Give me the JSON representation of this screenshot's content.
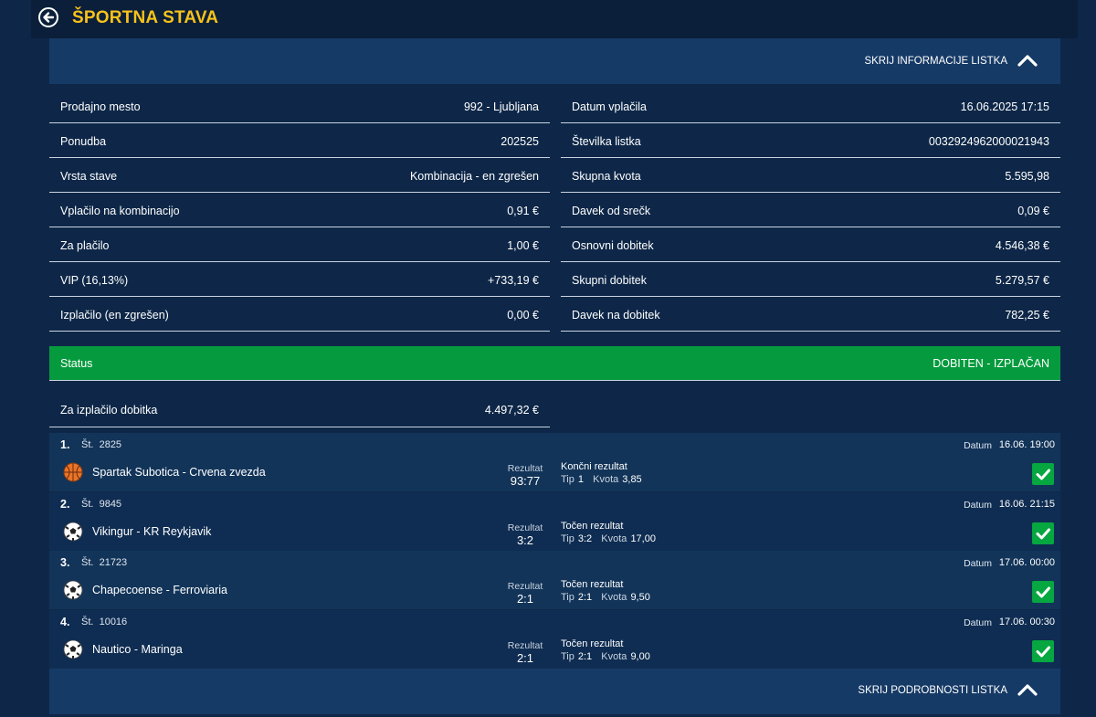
{
  "header": {
    "title": "ŠPORTNA STAVA"
  },
  "info_toggle": {
    "label": "SKRIJ INFORMACIJE LISTKA"
  },
  "info_left": [
    {
      "label": "Prodajno mesto",
      "value": "992 - Ljubljana"
    },
    {
      "label": "Ponudba",
      "value": "202525"
    },
    {
      "label": "Vrsta stave",
      "value": "Kombinacija - en zgrešen"
    },
    {
      "label": "Vplačilo na kombinacijo",
      "value": "0,91 €"
    },
    {
      "label": "Za plačilo",
      "value": "1,00 €"
    },
    {
      "label": "VIP (16,13%)",
      "value": "+733,19 €"
    },
    {
      "label": "Izplačilo (en zgrešen)",
      "value": "0,00 €"
    }
  ],
  "info_right": [
    {
      "label": "Datum vplačila",
      "value": "16.06.2025 17:15"
    },
    {
      "label": "Številka listka",
      "value": "0032924962000021943"
    },
    {
      "label": "Skupna kvota",
      "value": "5.595,98"
    },
    {
      "label": "Davek od srečk",
      "value": "0,09 €"
    },
    {
      "label": "Osnovni dobitek",
      "value": "4.546,38 €"
    },
    {
      "label": "Skupni dobitek",
      "value": "5.279,57 €"
    },
    {
      "label": "Davek na dobitek",
      "value": "782,25 €"
    }
  ],
  "status": {
    "label": "Status",
    "value": "DOBITEN - IZPLAČAN",
    "color": "#069a3e"
  },
  "payout": {
    "label": "Za izplačilo dobitka",
    "value": "4.497,32 €"
  },
  "matches": [
    {
      "num": "1.",
      "st_label": "Št.",
      "st": "2825",
      "date_label": "Datum",
      "date": "16.06. 19:00",
      "sport_icon": "basketball-icon",
      "name": "Spartak Subotica - Crvena zvezda",
      "result_label": "Rezultat",
      "result": "93:77",
      "market": "Končni rezultat",
      "tip_label": "Tip",
      "tip": "1",
      "odds_label": "Kvota",
      "odds": "3,85"
    },
    {
      "num": "2.",
      "st_label": "Št.",
      "st": "9845",
      "date_label": "Datum",
      "date": "16.06. 21:15",
      "sport_icon": "soccer-ball-icon",
      "name": "Vikingur - KR Reykjavik",
      "result_label": "Rezultat",
      "result": "3:2",
      "market": "Točen rezultat",
      "tip_label": "Tip",
      "tip": "3:2",
      "odds_label": "Kvota",
      "odds": "17,00"
    },
    {
      "num": "3.",
      "st_label": "Št.",
      "st": "21723",
      "date_label": "Datum",
      "date": "17.06. 00:00",
      "sport_icon": "soccer-ball-icon",
      "name": "Chapecoense - Ferroviaria",
      "result_label": "Rezultat",
      "result": "2:1",
      "market": "Točen rezultat",
      "tip_label": "Tip",
      "tip": "2:1",
      "odds_label": "Kvota",
      "odds": "9,50"
    },
    {
      "num": "4.",
      "st_label": "Št.",
      "st": "10016",
      "date_label": "Datum",
      "date": "17.06. 00:30",
      "sport_icon": "soccer-ball-icon",
      "name": "Nautico - Maringa",
      "result_label": "Rezultat",
      "result": "2:1",
      "market": "Točen rezultat",
      "tip_label": "Tip",
      "tip": "2:1",
      "odds_label": "Kvota",
      "odds": "9,00"
    }
  ],
  "details_toggle": {
    "label": "SKRIJ PODROBNOSTI LISTKA"
  },
  "colors": {
    "title": "#f7c21a",
    "win_check": "#06a640",
    "panel": "#163a66"
  }
}
